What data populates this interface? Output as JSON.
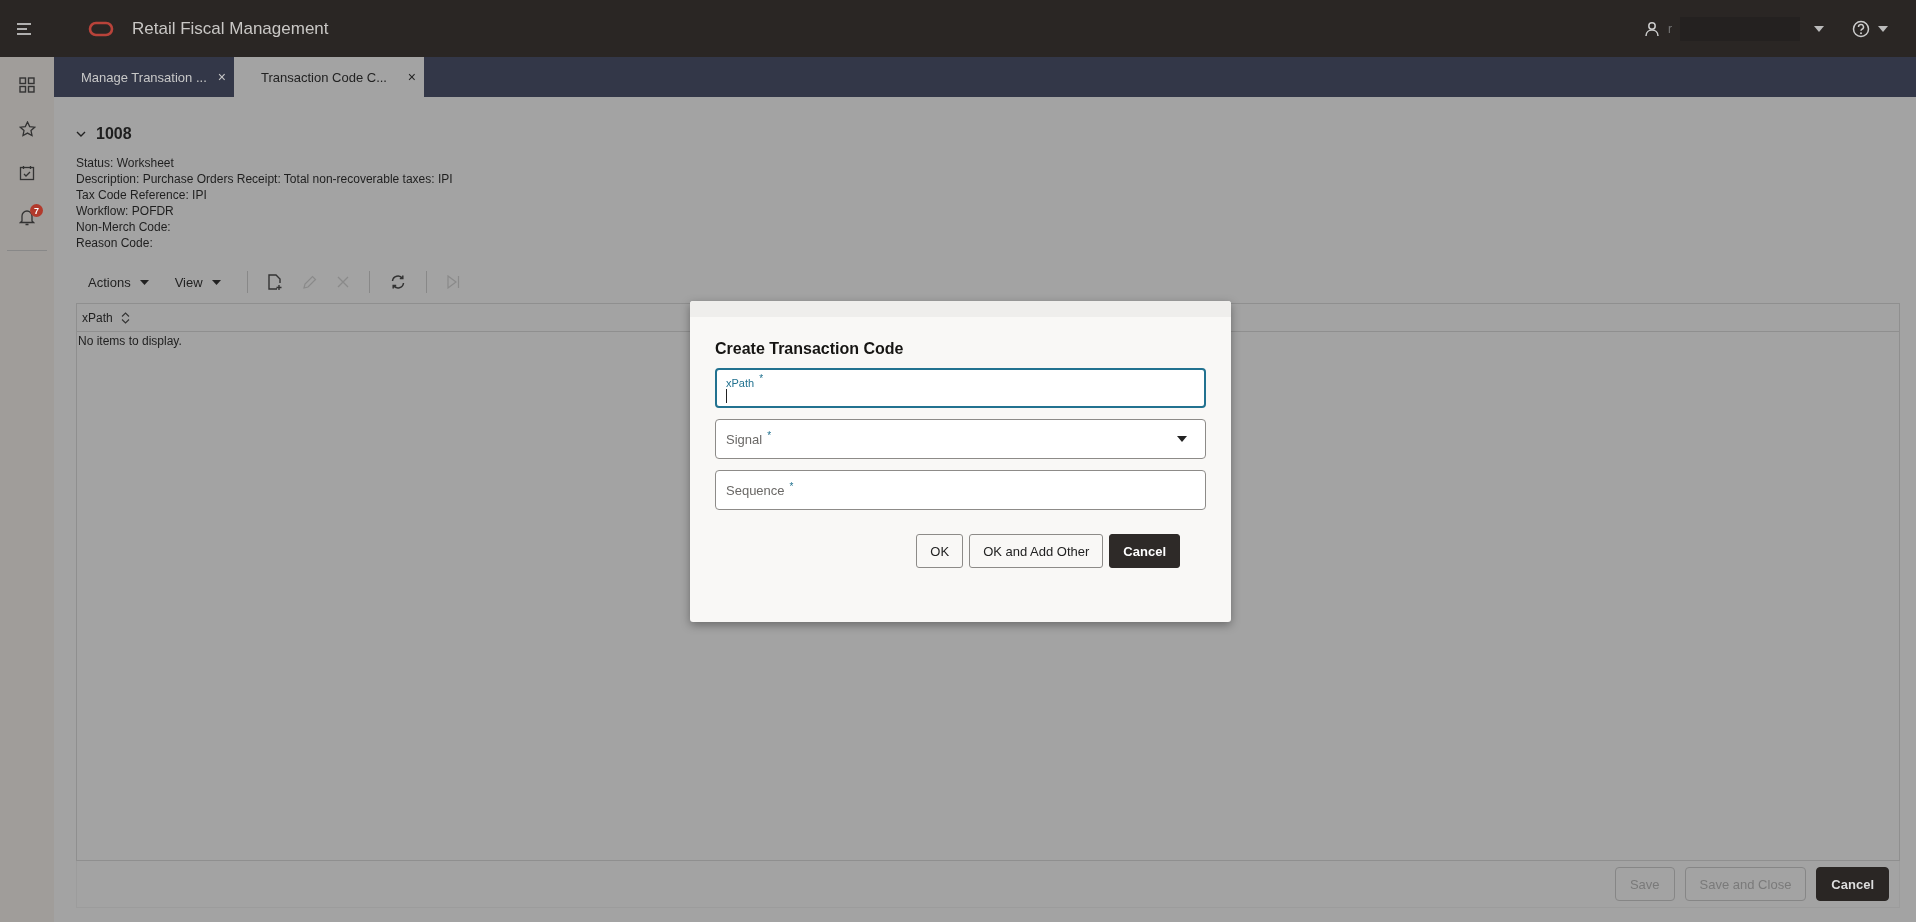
{
  "app_title": "Retail Fiscal Management",
  "user": {
    "name": "r"
  },
  "tabs": [
    {
      "label": "Manage Transation ...",
      "selected": false,
      "close": "×"
    },
    {
      "label": "Transaction Code C...",
      "selected": true,
      "close": "×"
    }
  ],
  "sidebar": {
    "items": [
      {
        "kind": "grid"
      },
      {
        "kind": "star"
      },
      {
        "kind": "calendar"
      },
      {
        "kind": "bell",
        "badge": "7"
      }
    ]
  },
  "record": {
    "title": "1008",
    "expanded": true,
    "details": [
      "Status: Worksheet",
      "Description: Purchase Orders Receipt: Total non-recoverable taxes: IPI",
      "Tax Code Reference: IPI",
      "Workflow: POFDR",
      "Non-Merch Code:",
      "Reason Code:"
    ]
  },
  "toolbar": {
    "menus": [
      "Actions",
      "View"
    ],
    "icons": [
      {
        "kind": "new",
        "disabled": false
      },
      {
        "kind": "edit",
        "disabled": true
      },
      {
        "kind": "delete",
        "disabled": true
      },
      {
        "kind": "refresh",
        "disabled": false
      },
      {
        "kind": "last",
        "disabled": true
      }
    ]
  },
  "table": {
    "columns": [
      "xPath"
    ],
    "empty_text": "No items to display."
  },
  "footer_buttons": [
    {
      "label": "Save",
      "kind": "default",
      "disabled": true
    },
    {
      "label": "Save and Close",
      "kind": "default",
      "disabled": true
    },
    {
      "label": "Cancel",
      "kind": "primary",
      "disabled": false
    }
  ],
  "dialog": {
    "title": "Create Transaction Code",
    "fields": [
      {
        "label": "xPath",
        "required_mark": "*",
        "kind": "text",
        "focused": true
      },
      {
        "label": "Signal",
        "required_mark": "*",
        "kind": "select",
        "focused": false
      },
      {
        "label": "Sequence",
        "required_mark": "*",
        "kind": "text",
        "focused": false
      }
    ],
    "buttons": [
      {
        "label": "OK",
        "kind": "default"
      },
      {
        "label": "OK and Add Other",
        "kind": "default"
      },
      {
        "label": "Cancel",
        "kind": "primary"
      }
    ]
  }
}
